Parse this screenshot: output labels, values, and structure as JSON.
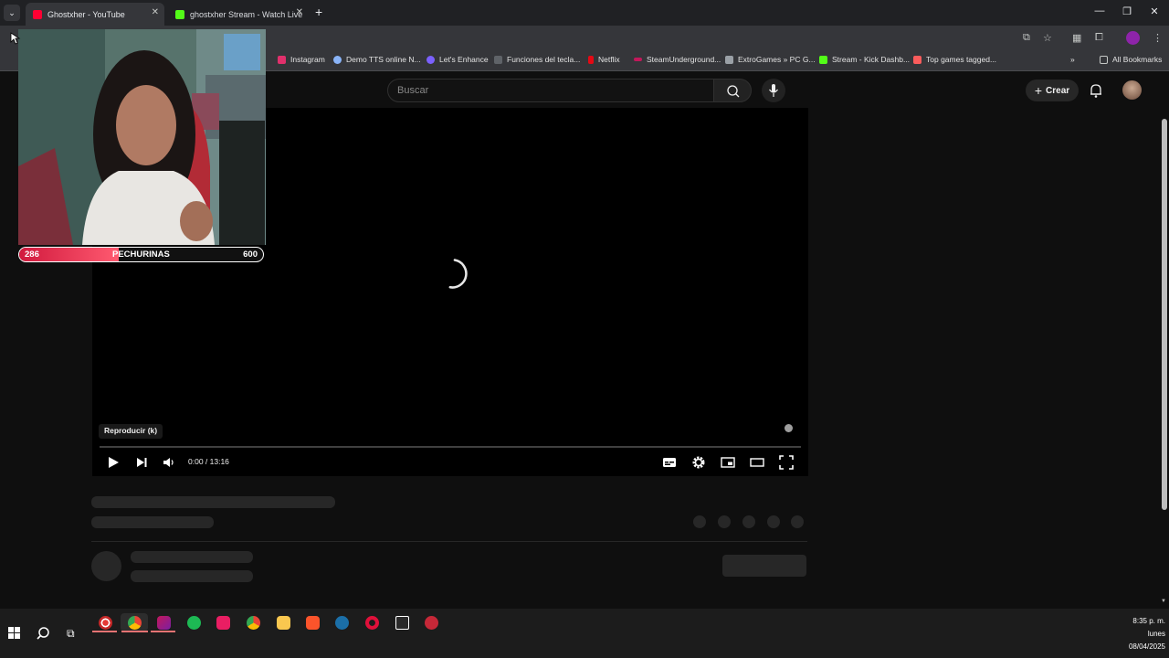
{
  "tabs": [
    {
      "title": "Ghostxher - YouTube",
      "active": true,
      "favicon_color": "#ff0033"
    },
    {
      "title": "ghostxher Stream - Watch Live",
      "active": false,
      "favicon_color": "#53fc18"
    }
  ],
  "new_tab_label": "+",
  "bookmarks": [
    {
      "label": "Instagram",
      "color": "#e1306c"
    },
    {
      "label": "Demo TTS online N...",
      "color": "#8ab4f8"
    },
    {
      "label": "Let's Enhance",
      "color": "#7b61ff"
    },
    {
      "label": "Funciones del tecla...",
      "color": "#5f6368"
    },
    {
      "label": "Netflix",
      "color": "#e50914"
    },
    {
      "label": "SteamUnderground...",
      "color": "#c2185b"
    },
    {
      "label": "ExtroGames » PC G...",
      "color": "#9aa0a6"
    },
    {
      "label": "Stream - Kick Dashb...",
      "color": "#53fc18"
    },
    {
      "label": "Top games tagged...",
      "color": "#fa5c5c"
    }
  ],
  "all_bookmarks_label": "All Bookmarks",
  "search": {
    "placeholder": "Buscar"
  },
  "create_label": "Crear",
  "player": {
    "tooltip": "Reproducir (k)",
    "time": "0:00 / 13:16",
    "progress": 0
  },
  "webcam_bar": {
    "left_value": "286",
    "label": "PECHURINAS",
    "right_value": "600",
    "fill_fraction": 0.41,
    "color": "#e0234a"
  },
  "taskbar": {
    "apps": [
      "chrome-profile-icon",
      "chrome-icon",
      "photo-app-icon",
      "spotify-icon",
      "tiktok-icon",
      "google-chrome-icon",
      "file-explorer-icon",
      "brave-icon",
      "steam-icon",
      "opera-icon",
      "epic-games-icon",
      "t-app-icon"
    ],
    "clock": {
      "time": "8:35 p. m.",
      "day": "lunes",
      "date": "08/04/2025"
    }
  }
}
